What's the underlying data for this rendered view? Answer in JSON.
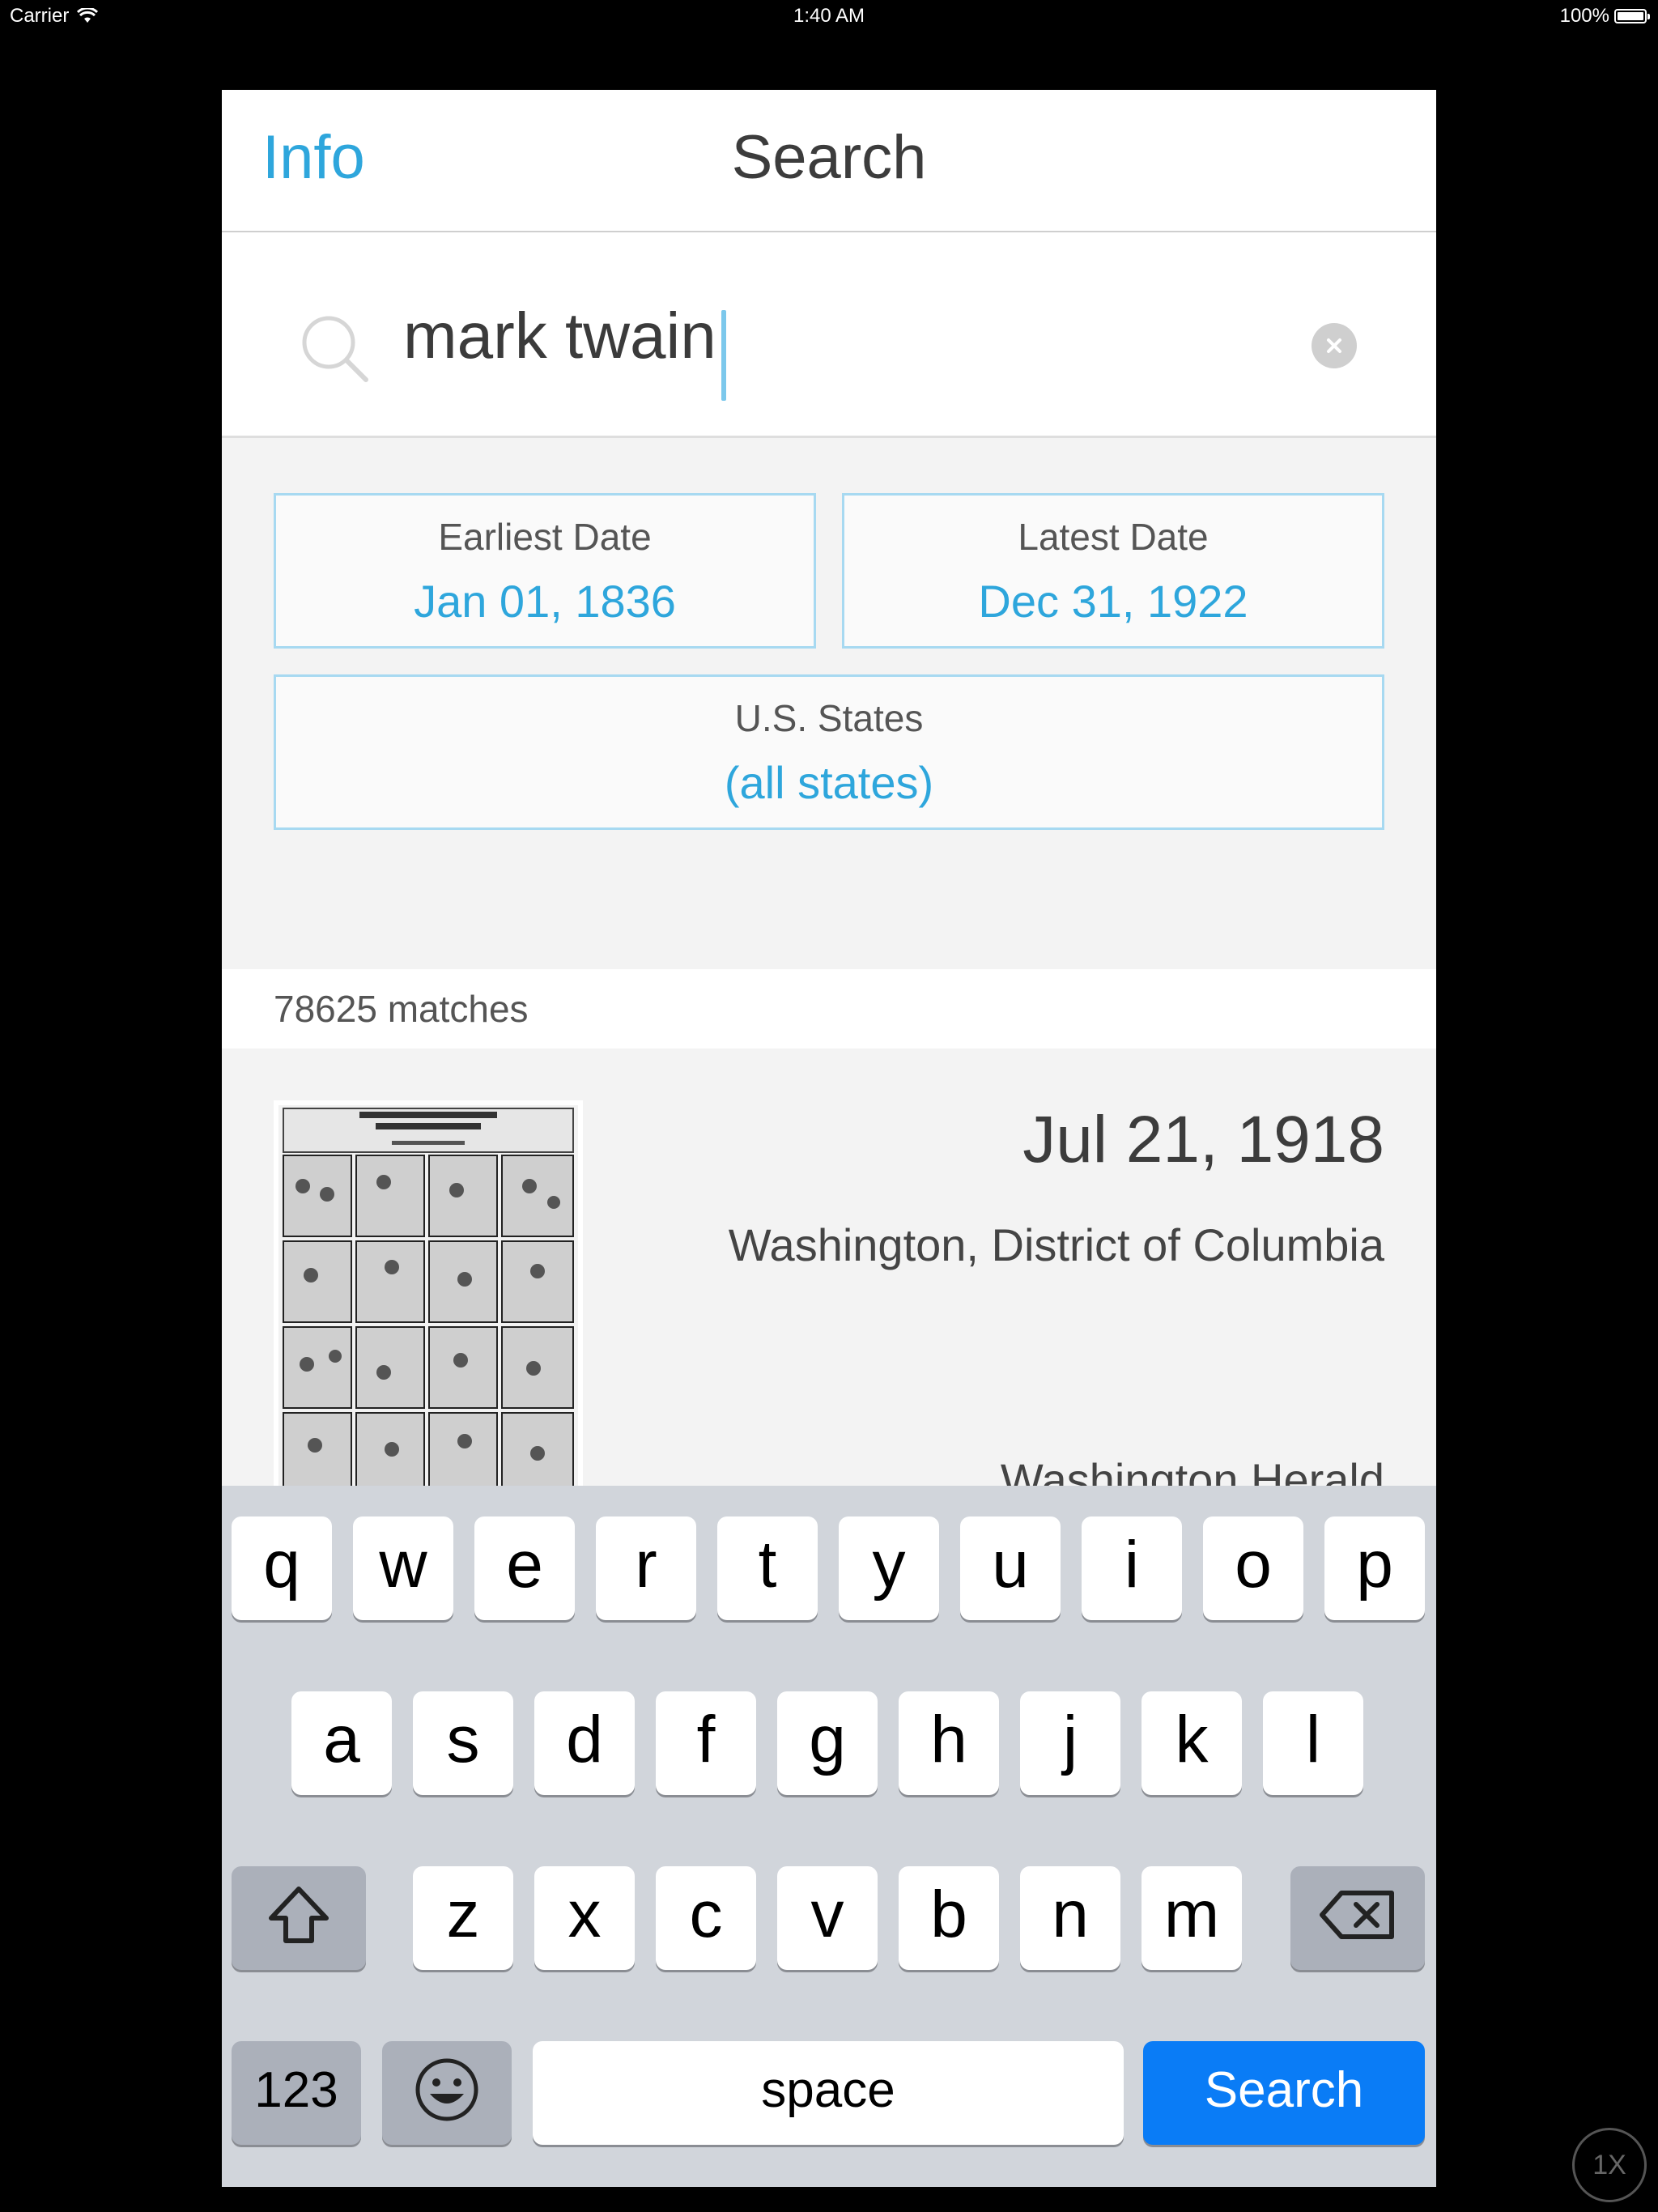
{
  "status_bar": {
    "carrier": "Carrier",
    "time": "1:40 AM",
    "battery": "100%"
  },
  "nav": {
    "left_button": "Info",
    "title": "Search"
  },
  "search": {
    "query": "mark twain",
    "placeholder": ""
  },
  "filters": {
    "earliest": {
      "label": "Earliest Date",
      "value": "Jan 01, 1836"
    },
    "latest": {
      "label": "Latest Date",
      "value": "Dec 31, 1922"
    },
    "states": {
      "label": "U.S. States",
      "value": "(all states)"
    }
  },
  "results": {
    "count_text": "78625 matches",
    "items": [
      {
        "date": "Jul 21, 1918",
        "place": "Washington, District of Columbia",
        "paper": "Washington Herald"
      }
    ]
  },
  "keyboard": {
    "row1": [
      "q",
      "w",
      "e",
      "r",
      "t",
      "y",
      "u",
      "i",
      "o",
      "p"
    ],
    "row2": [
      "a",
      "s",
      "d",
      "f",
      "g",
      "h",
      "j",
      "k",
      "l"
    ],
    "row3": [
      "z",
      "x",
      "c",
      "v",
      "b",
      "n",
      "m"
    ],
    "numbers_key": "123",
    "space_key": "space",
    "action_key": "Search"
  },
  "zoom_badge": "1X",
  "colors": {
    "accent": "#2ea6dc",
    "search_key": "#0a7cf6",
    "keyboard_bg": "#d1d5db"
  }
}
